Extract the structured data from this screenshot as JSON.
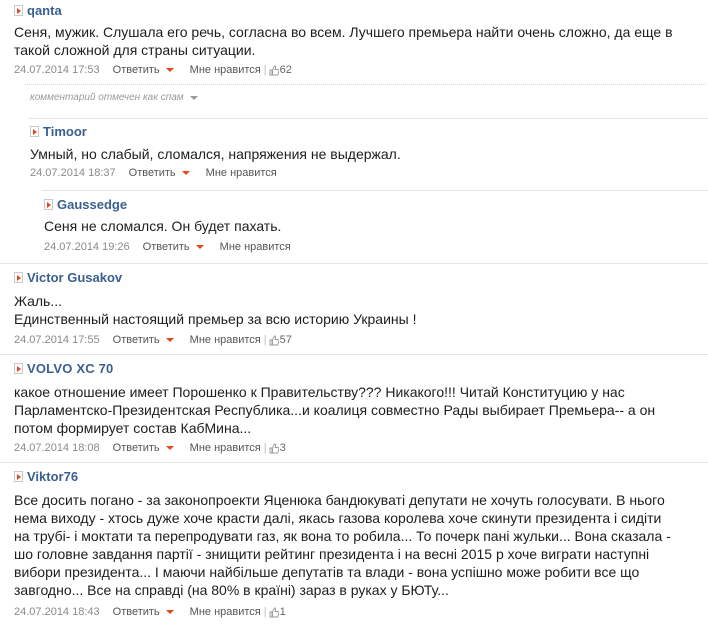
{
  "common": {
    "reply_label": "Ответить",
    "like_label": "Мне нравится",
    "separator": "|"
  },
  "spam_notice": "комментарий отмечен как спам",
  "comments": [
    {
      "author": "qanta",
      "lines": [
        "Сеня, мужик. Слушала его речь, согласна во всем. Лучшего премьера найти очень сложно, да еще в",
        "такой сложной для страны ситуации."
      ],
      "date": "24.07.2014 17:53",
      "likes": "62"
    },
    {
      "author": "Timoor",
      "lines": [
        "Умный, но слабый, сломался, напряжения не выдержал."
      ],
      "date": "24.07.2014 18:37",
      "likes": ""
    },
    {
      "author": "Gaussedge",
      "lines": [
        "Сеня не сломался. Он будет пахать."
      ],
      "date": "24.07.2014 19:26",
      "likes": ""
    },
    {
      "author": "Victor Gusakov",
      "lines": [
        "Жаль...",
        "Единственный настоящий премьер за всю историю Украины !"
      ],
      "date": "24.07.2014 17:55",
      "likes": "57"
    },
    {
      "author": "VOLVO XC 70",
      "lines": [
        "какое отношение имеет Порошенко к Правительству??? Никакого!!! Читай Конституцию у нас",
        "Парламентско-Президентская Республика...и коалиця совместно Рады выбирает Премьера-- а он",
        "потом формирует состав КабМина..."
      ],
      "date": "24.07.2014 18:08",
      "likes": "3"
    },
    {
      "author": "Viktor76",
      "lines": [
        "Все досить погано - за законопроекти Яценюка бандюкуваті депутати не хочуть голосувати. В нього",
        "нема виходу - хтось дуже хоче красти далі, якась газова королева хоче скинути президента і сидіти",
        "на трубі- і моктати та перепродувати газ, як вона то робила... То почерк пані жульки... Вона сказала -",
        "шо головне завдання партії - знищити рейтинг президента і на весні 2015 р хоче виграти наступні",
        "вибори президента... І маючи найбільше депутатів та влади - вона успішно може робити все що",
        "завгодно... Все на справді (на 80% в країні) зараз в руках у БЮТу..."
      ],
      "date": "24.07.2014 18:43",
      "likes": "1"
    }
  ]
}
